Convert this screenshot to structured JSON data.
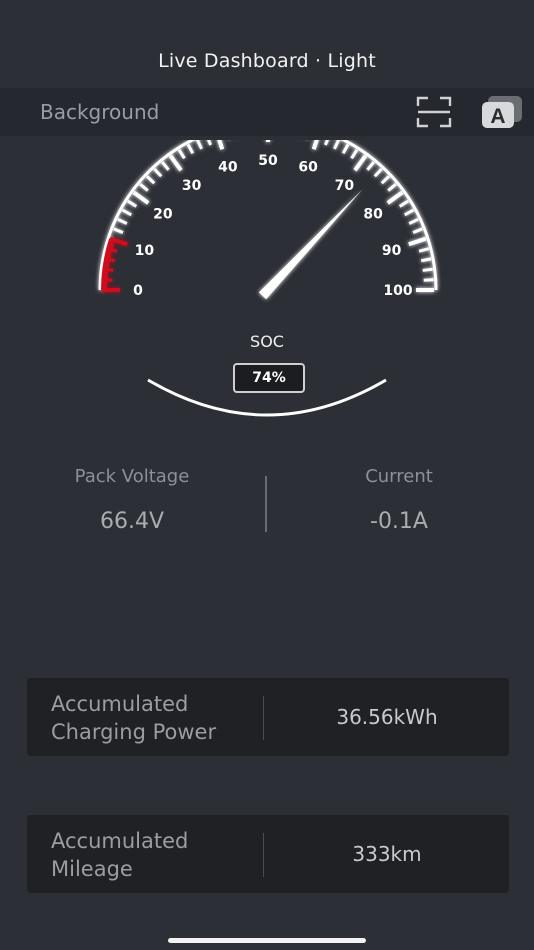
{
  "header": {
    "title": "Live Dashboard · Light"
  },
  "background_bar": {
    "label": "Background",
    "scan_icon": "scan-frame-icon",
    "font_icon": "font-a-icon",
    "font_icon_letter": "A"
  },
  "gauge": {
    "ticks": [
      "0",
      "10",
      "20",
      "30",
      "40",
      "50",
      "60",
      "70",
      "80",
      "90",
      "100"
    ],
    "min": 0,
    "max": 100,
    "value": 74,
    "low_zone_color": "#d0101c",
    "label": "SOC",
    "readout": "74%"
  },
  "metrics": {
    "voltage": {
      "label": "Pack Voltage",
      "value": "66.4V"
    },
    "current": {
      "label": "Current",
      "value": "-0.1A"
    }
  },
  "cards": {
    "charging": {
      "label_line1": "Accumulated",
      "label_line2": "Charging Power",
      "value": "36.56kWh"
    },
    "mileage": {
      "label_line1": "Accumulated",
      "label_line2": "Mileage",
      "value": "333km"
    }
  }
}
